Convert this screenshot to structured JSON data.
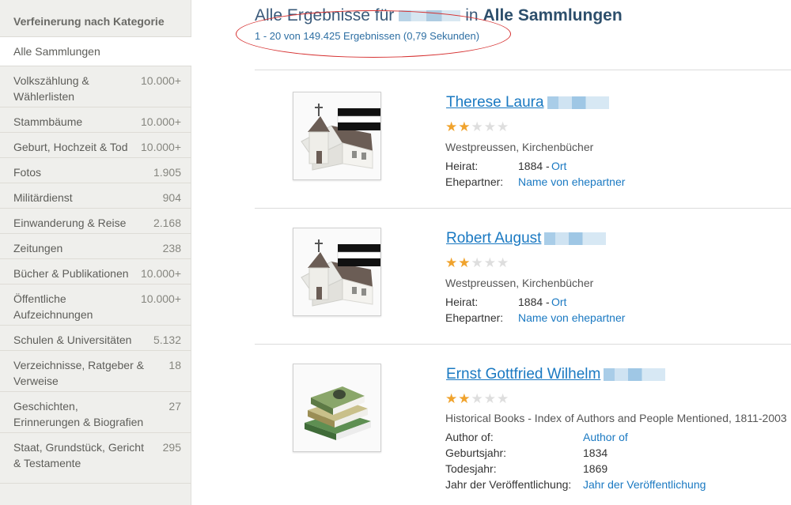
{
  "sidebar": {
    "header": "Verfeinerung nach Kategorie",
    "active": "Alle Sammlungen",
    "items": [
      {
        "label": "Volkszählung & Wählerlisten",
        "count": "10.000+"
      },
      {
        "label": "Stammbäume",
        "count": "10.000+"
      },
      {
        "label": "Geburt, Hochzeit & Tod",
        "count": "10.000+"
      },
      {
        "label": "Fotos",
        "count": "1.905"
      },
      {
        "label": "Militärdienst",
        "count": "904"
      },
      {
        "label": "Einwanderung & Reise",
        "count": "2.168"
      },
      {
        "label": "Zeitungen",
        "count": "238"
      },
      {
        "label": "Bücher & Publikationen",
        "count": "10.000+"
      },
      {
        "label": "Öffentliche Aufzeichnungen",
        "count": "10.000+"
      },
      {
        "label": "Schulen & Universitäten",
        "count": "5.132"
      },
      {
        "label": "Verzeichnisse, Ratgeber & Verweise",
        "count": "18"
      },
      {
        "label": "Geschichten, Erinnerungen & Biografien",
        "count": "27"
      },
      {
        "label": "Staat, Grundstück, Gericht & Testamente",
        "count": "295"
      }
    ]
  },
  "header": {
    "title_prefix": "Alle Ergebnisse für",
    "title_mid": "in",
    "title_collection": "Alle Sammlungen",
    "count": "1 - 20 von 149.425 Ergebnissen (0,79 Sekunden)"
  },
  "results": [
    {
      "name": "Therese Laura",
      "rating": 2,
      "source": "Westpreussen, Kirchenbücher",
      "fields": [
        {
          "label": "Heirat:",
          "value": "1884 -",
          "link": "Ort"
        },
        {
          "label": "Ehepartner:",
          "value": "",
          "link": "Name von ehepartner"
        }
      ]
    },
    {
      "name": "Robert August",
      "rating": 2,
      "source": "Westpreussen, Kirchenbücher",
      "fields": [
        {
          "label": "Heirat:",
          "value": "1884 -",
          "link": "Ort"
        },
        {
          "label": "Ehepartner:",
          "value": "",
          "link": "Name von ehepartner"
        }
      ]
    },
    {
      "name": "Ernst Gottfried Wilhelm",
      "rating": 2,
      "source": "Historical Books - Index of Authors and People Mentioned, 1811-2003",
      "fields": [
        {
          "label": "Author of:",
          "value": "",
          "link": "Author of"
        },
        {
          "label": "Geburtsjahr:",
          "value": "1834",
          "link": ""
        },
        {
          "label": "Todesjahr:",
          "value": "1869",
          "link": ""
        },
        {
          "label": "Jahr der Veröffentlichung:",
          "value": "",
          "link": "Jahr der Veröffentlichung"
        }
      ]
    }
  ],
  "colors": {
    "link": "#1a79c2",
    "star": "#f0a32d",
    "annotation": "#d63030"
  }
}
